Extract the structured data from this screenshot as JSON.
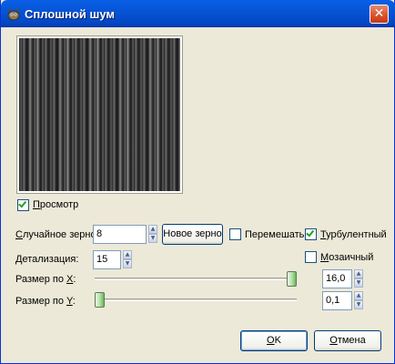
{
  "window": {
    "title": "Сплошной шум",
    "close_glyph": "✕"
  },
  "preview": {
    "checked": true,
    "label_underlined": "П",
    "label_rest": "росмотр"
  },
  "seed": {
    "label_underlined": "С",
    "label_rest": "лучайное зерно:",
    "value": "8",
    "new_seed_button": "Новое зерно"
  },
  "randomize": {
    "checked": false,
    "label": "Перемешать"
  },
  "turbulent": {
    "checked": true,
    "label_underlined": "Т",
    "label_rest": "урбулентный"
  },
  "detail": {
    "label_underlined": "Д",
    "label_rest": "етализация:",
    "value": "15"
  },
  "tileable": {
    "checked": false,
    "label_underlined": "М",
    "label_rest": "озаичный"
  },
  "x_size": {
    "label_prefix": "Размер по ",
    "label_underlined": "X",
    "label_suffix": ":",
    "value": "16,0",
    "slider_fraction": 1.0
  },
  "y_size": {
    "label_prefix": "Размер по ",
    "label_underlined": "Y",
    "label_suffix": ":",
    "value": "0,1",
    "slider_fraction": 0.0
  },
  "buttons": {
    "ok_underlined": "O",
    "ok_rest": "K",
    "cancel_underlined": "О",
    "cancel_rest": "тмена"
  },
  "icons": {
    "title": "gimp-icon",
    "close": "close-icon",
    "spin_up": "spin-up-icon",
    "spin_down": "spin-down-icon"
  },
  "colors": {
    "titlebar": "#0655d6",
    "dialog_bg": "#ece9d8",
    "check_mark": "#21a121"
  }
}
